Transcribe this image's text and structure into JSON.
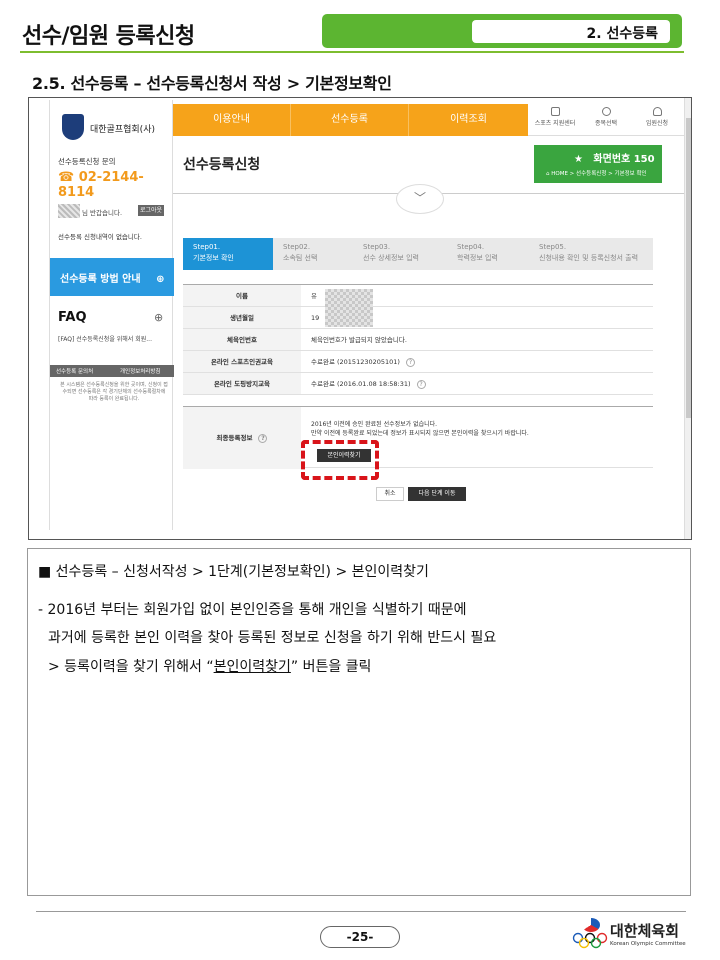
{
  "doc": {
    "title": "선수/임원 등록신청",
    "section_badge": "2. 선수등록",
    "subheading": "2.5. 선수등록 – 선수등록신청서 작성 > 기본정보확인"
  },
  "sidebar": {
    "org_name": "대한골프협회(사)",
    "inquiry_label": "선수등록신청 문의",
    "inquiry_phone": "02-2144-8114",
    "greeting": "님 반갑습니다.",
    "logout": "로그아웃",
    "no_history": "선수등록 신청내역이 없습니다.",
    "guide_button": "선수등록 방법 안내",
    "guide_icon": "plus-circle-icon",
    "faq_title": "FAQ",
    "faq_item": "[FAQ] 선수등록신청을 위해서 회원...",
    "tabs": [
      "선수등록 문의처",
      "개인정보처리방침"
    ],
    "note": "본 시스템은 선수등록신청을 위한 곳이며, 신청이 접수되면 선수등록은 각 경기단체의 선수등록절차에 따라 등록이 완료됩니다."
  },
  "nav": {
    "items": [
      "이용안내",
      "선수등록",
      "이력조회"
    ],
    "utility": [
      "스포츠 지원센터",
      "종목선택",
      "임원신청"
    ]
  },
  "page": {
    "heading": "선수등록신청",
    "screen_no": "화면번호 150",
    "crumb": "HOME > 선수등록신청 > 기본정보 확인"
  },
  "steps": [
    {
      "no": "Step01.",
      "label": "기본정보 확인"
    },
    {
      "no": "Step02.",
      "label": "소속팀 선택"
    },
    {
      "no": "Step03.",
      "label": "선수 상세정보 입력"
    },
    {
      "no": "Step04.",
      "label": "학력정보 입력"
    },
    {
      "no": "Step05.",
      "label": "신청내용 확인 및 등록신청서 출력"
    }
  ],
  "info": {
    "rows": [
      {
        "label": "이름",
        "value": "유"
      },
      {
        "label": "생년월일",
        "value": "19"
      },
      {
        "label": "체육인번호",
        "value": "체육인번호가 발급되지 않았습니다."
      },
      {
        "label": "온라인 스포츠인권교육",
        "value": "수료완료 (20151230205101)"
      },
      {
        "label": "온라인 도핑방지교육",
        "value": "수료완료 (2016.01.08 18:58:31)"
      }
    ],
    "final_label": "최종등록정보",
    "final_msg1": "2016년 이전에 승인 완료된 선수정보가 없습니다.",
    "final_msg2": "만약 이전에 등록완료 되었는데 정보가 표시되지 않으면 본인이력을 찾으시기 바랍니다.",
    "find_button": "본인이력찾기",
    "cancel_button": "취소",
    "next_button": "다음 단계 이동"
  },
  "explain": {
    "head": "■ 선수등록 – 신청서작성 > 1단계(기본정보확인) > 본인이력찾기",
    "line1": "- 2016년 부터는 회원가입 없이 본인인증을 통해 개인을 식별하기 때문에",
    "line2": "과거에 등록한 본인 이력을 찾아 등록된 정보로 신청을 하기 위해 반드시 필요",
    "line3_pre": "> 등록이력을 찾기 위해서 “",
    "line3_link": "본인이력찾기",
    "line3_post": "” 버튼을 클릭"
  },
  "footer": {
    "page_no": "-25-",
    "logo_kr": "대한체육회",
    "logo_en": "Korean Olympic Committee"
  },
  "colors": {
    "green": "#5cb531",
    "orange": "#f6a31a",
    "blue": "#1d93d6",
    "red": "#d9141a"
  }
}
